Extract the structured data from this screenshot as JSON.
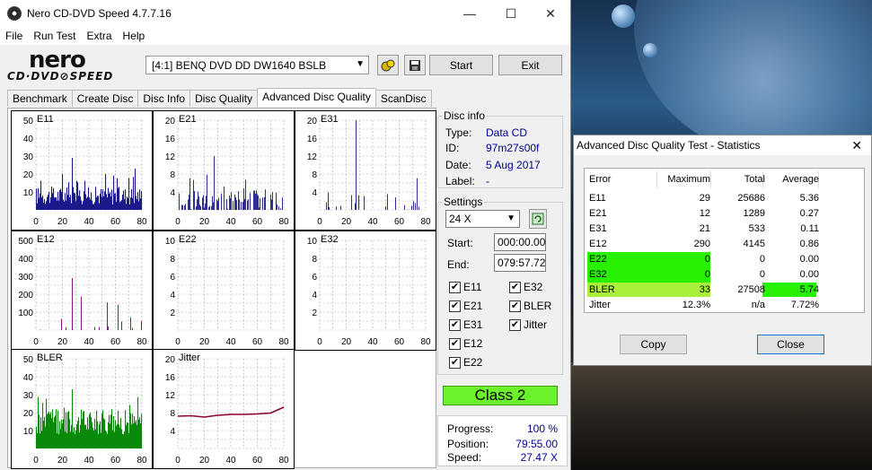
{
  "window": {
    "title": "Nero CD-DVD Speed 4.7.7.16",
    "min_icon": "minimize-icon",
    "max_icon": "maximize-icon",
    "close_icon": "close-icon"
  },
  "menu": [
    "File",
    "Run Test",
    "Extra",
    "Help"
  ],
  "brand": {
    "line1": "nero",
    "line2": "CD·DVD⊘SPEED"
  },
  "toolbar": {
    "drive": "[4:1]   BENQ DVD DD DW1640 BSLB",
    "start_label": "Start",
    "exit_label": "Exit"
  },
  "tabs": [
    "Benchmark",
    "Create Disc",
    "Disc Info",
    "Disc Quality",
    "Advanced Disc Quality",
    "ScanDisc"
  ],
  "active_tab": 4,
  "panels": [
    {
      "name": "E11",
      "yticks": [
        "50",
        "40",
        "30",
        "20",
        "10"
      ],
      "ymax": 50,
      "color": "#1a1a8c"
    },
    {
      "name": "E21",
      "yticks": [
        "20",
        "16",
        "12",
        "8",
        "4"
      ],
      "ymax": 20,
      "color": "#1a1a8c"
    },
    {
      "name": "E31",
      "yticks": [
        "20",
        "16",
        "12",
        "8",
        "4"
      ],
      "ymax": 20,
      "color": "#1a1a8c"
    },
    {
      "name": "E12",
      "yticks": [
        "500",
        "400",
        "300",
        "200",
        "100"
      ],
      "ymax": 500,
      "color": "#7a0070"
    },
    {
      "name": "E22",
      "yticks": [
        "10",
        "8",
        "6",
        "4",
        "2"
      ],
      "ymax": 10,
      "color": "#7a0070"
    },
    {
      "name": "E32",
      "yticks": [
        "10",
        "8",
        "6",
        "4",
        "2"
      ],
      "ymax": 10,
      "color": "#7a0070"
    },
    {
      "name": "BLER",
      "yticks": [
        "50",
        "40",
        "30",
        "20",
        "10"
      ],
      "ymax": 50,
      "color": "#0a8a0a"
    },
    {
      "name": "Jitter",
      "yticks": [
        "20",
        "16",
        "12",
        "8",
        "4"
      ],
      "ymax": 20,
      "color": "#8a0030"
    }
  ],
  "xticks": [
    "0",
    "20",
    "40",
    "60",
    "80"
  ],
  "disc_info": {
    "legend": "Disc info",
    "type_label": "Type:",
    "type_value": "Data CD",
    "id_label": "ID:",
    "id_value": "97m27s00f",
    "date_label": "Date:",
    "date_value": "5 Aug 2017",
    "label_label": "Label:",
    "label_value": "-"
  },
  "settings": {
    "legend": "Settings",
    "speed": "24 X",
    "start_label": "Start:",
    "start_value": "000:00.00",
    "end_label": "End:",
    "end_value": "079:57.72",
    "checks": [
      {
        "label": "E11",
        "checked": true
      },
      {
        "label": "E32",
        "checked": true
      },
      {
        "label": "E21",
        "checked": true
      },
      {
        "label": "BLER",
        "checked": true
      },
      {
        "label": "E31",
        "checked": true
      },
      {
        "label": "Jitter",
        "checked": true
      },
      {
        "label": "E12",
        "checked": true
      },
      {
        "label": "E22",
        "checked": true
      }
    ]
  },
  "class_label": "Class 2",
  "progress": {
    "progress_label": "Progress:",
    "progress_value": "100 %",
    "position_label": "Position:",
    "position_value": "79:55.00",
    "speed_label": "Speed:",
    "speed_value": "27.47 X"
  },
  "stats": {
    "title": "Advanced Disc Quality Test - Statistics",
    "headers": [
      "Error",
      "Maximum",
      "Total",
      "Average"
    ],
    "rows": [
      [
        "E11",
        "29",
        "25686",
        "5.36"
      ],
      [
        "E21",
        "12",
        "1289",
        "0.27"
      ],
      [
        "E31",
        "21",
        "533",
        "0.11"
      ],
      [
        "E12",
        "290",
        "4145",
        "0.86"
      ],
      [
        "E22",
        "0",
        "0",
        "0.00"
      ],
      [
        "E32",
        "0",
        "0",
        "0.00"
      ],
      [
        "BLER",
        "33",
        "27508",
        "5.74"
      ],
      [
        "Jitter",
        "12.3%",
        "n/a",
        "7.72%"
      ]
    ],
    "copy_label": "Copy",
    "close_label": "Close",
    "highlight": "#27f000"
  },
  "chart_data": [
    {
      "type": "bar",
      "title": "E11",
      "xlim": [
        0,
        80
      ],
      "ylim": [
        0,
        50
      ],
      "values_note": "per-minute error counts",
      "peak": 29
    },
    {
      "type": "bar",
      "title": "E21",
      "xlim": [
        0,
        80
      ],
      "ylim": [
        0,
        20
      ],
      "peak": 12
    },
    {
      "type": "bar",
      "title": "E31",
      "xlim": [
        0,
        80
      ],
      "ylim": [
        0,
        20
      ],
      "peak": 21
    },
    {
      "type": "bar",
      "title": "E12",
      "xlim": [
        0,
        80
      ],
      "ylim": [
        0,
        500
      ],
      "peak": 290
    },
    {
      "type": "bar",
      "title": "E22",
      "xlim": [
        0,
        80
      ],
      "ylim": [
        0,
        10
      ],
      "peak": 0
    },
    {
      "type": "bar",
      "title": "E32",
      "xlim": [
        0,
        80
      ],
      "ylim": [
        0,
        10
      ],
      "peak": 0
    },
    {
      "type": "bar",
      "title": "BLER",
      "xlim": [
        0,
        80
      ],
      "ylim": [
        0,
        50
      ],
      "peak": 33
    },
    {
      "type": "line",
      "title": "Jitter",
      "xlim": [
        0,
        80
      ],
      "ylim": [
        0,
        20
      ],
      "x": [
        0,
        10,
        20,
        30,
        40,
        50,
        60,
        70,
        80
      ],
      "y": [
        7.2,
        7.3,
        7.0,
        7.4,
        7.6,
        7.6,
        7.7,
        7.9,
        9.2
      ]
    }
  ]
}
